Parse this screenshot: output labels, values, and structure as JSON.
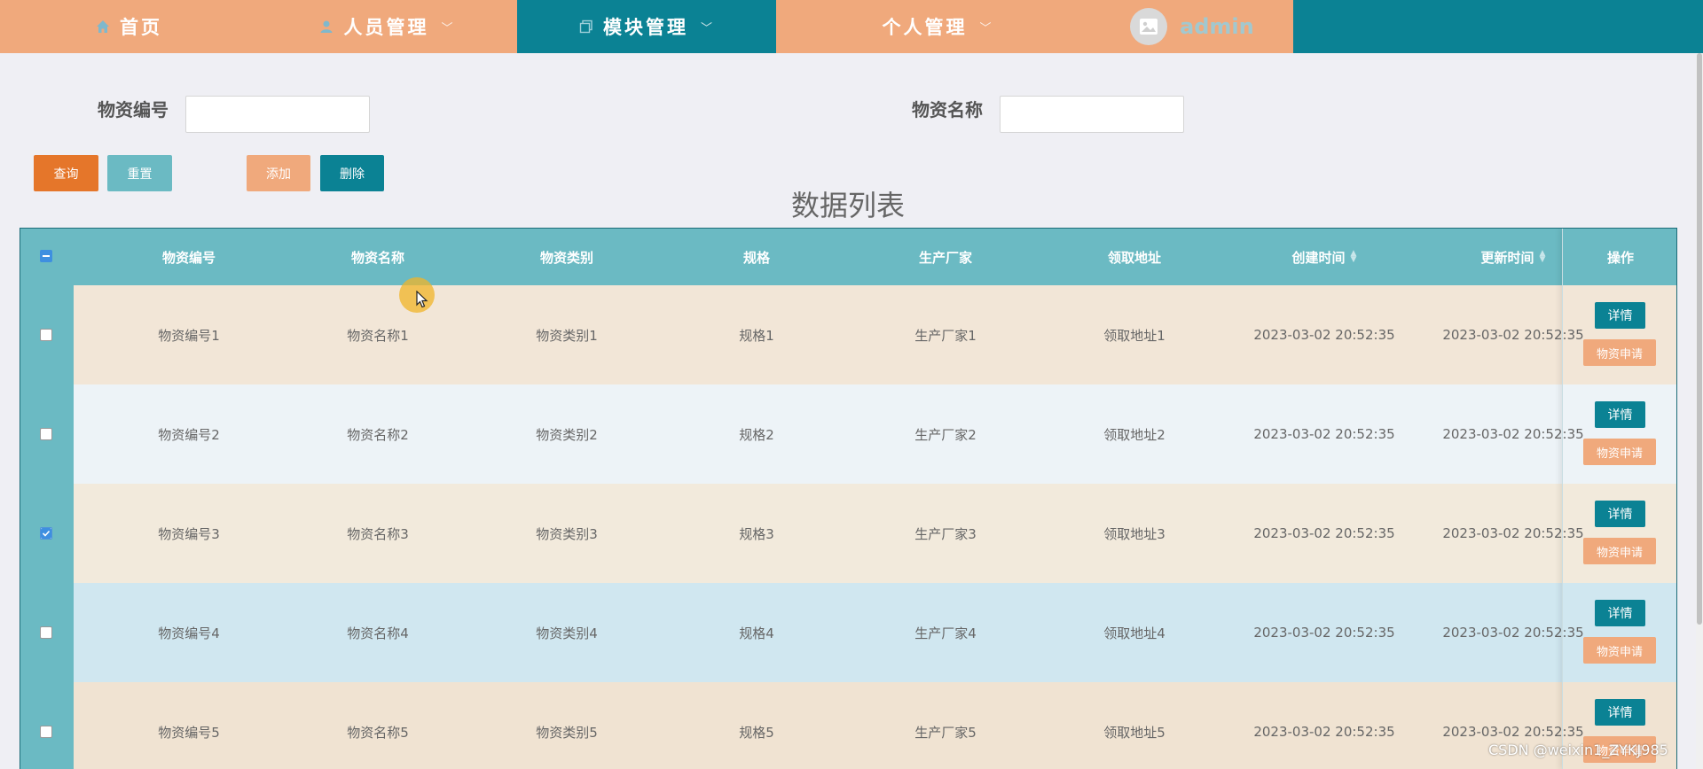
{
  "nav": {
    "items": [
      {
        "label": "首页",
        "icon": "home-icon"
      },
      {
        "label": "人员管理",
        "icon": "user-icon"
      },
      {
        "label": "模块管理",
        "icon": "module-icon"
      },
      {
        "label": "个人管理",
        "icon": ""
      }
    ],
    "username": "admin"
  },
  "search": {
    "field1_label": "物资编号",
    "field2_label": "物资名称",
    "query_label": "查询",
    "reset_label": "重置",
    "add_label": "添加",
    "delete_label": "删除"
  },
  "list_title": "数据列表",
  "table": {
    "headers": [
      "物资编号",
      "物资名称",
      "物资类别",
      "规格",
      "生产厂家",
      "领取地址",
      "创建时间",
      "更新时间",
      "操作"
    ],
    "rows": [
      {
        "code": "物资编号1",
        "name": "物资名称1",
        "category": "物资类别1",
        "spec": "规格1",
        "maker": "生产厂家1",
        "address": "领取地址1",
        "created": "2023-03-02 20:52:35",
        "updated": "2023-03-02 20:52:35",
        "checked": false
      },
      {
        "code": "物资编号2",
        "name": "物资名称2",
        "category": "物资类别2",
        "spec": "规格2",
        "maker": "生产厂家2",
        "address": "领取地址2",
        "created": "2023-03-02 20:52:35",
        "updated": "2023-03-02 20:52:35",
        "checked": false
      },
      {
        "code": "物资编号3",
        "name": "物资名称3",
        "category": "物资类别3",
        "spec": "规格3",
        "maker": "生产厂家3",
        "address": "领取地址3",
        "created": "2023-03-02 20:52:35",
        "updated": "2023-03-02 20:52:35",
        "checked": true
      },
      {
        "code": "物资编号4",
        "name": "物资名称4",
        "category": "物资类别4",
        "spec": "规格4",
        "maker": "生产厂家4",
        "address": "领取地址4",
        "created": "2023-03-02 20:52:35",
        "updated": "2023-03-02 20:52:35",
        "checked": false
      },
      {
        "code": "物资编号5",
        "name": "物资名称5",
        "category": "物资类别5",
        "spec": "规格5",
        "maker": "生产厂家5",
        "address": "领取地址5",
        "created": "2023-03-02 20:52:35",
        "updated": "2023-03-02 20:52:35",
        "checked": false
      }
    ],
    "detail_label": "详情",
    "apply_label": "物资申请"
  },
  "watermark": "CSDN @weixin1_ZYKJ985",
  "colors": {
    "teal": "#0b8294",
    "light_teal": "#6bbac3",
    "peach": "#f0a97c",
    "orange": "#e5762a",
    "row_colors": [
      "#f2e6d7",
      "#edf3f7",
      "#f2eadc",
      "#d0e7f0",
      "#f0e3d2"
    ]
  }
}
